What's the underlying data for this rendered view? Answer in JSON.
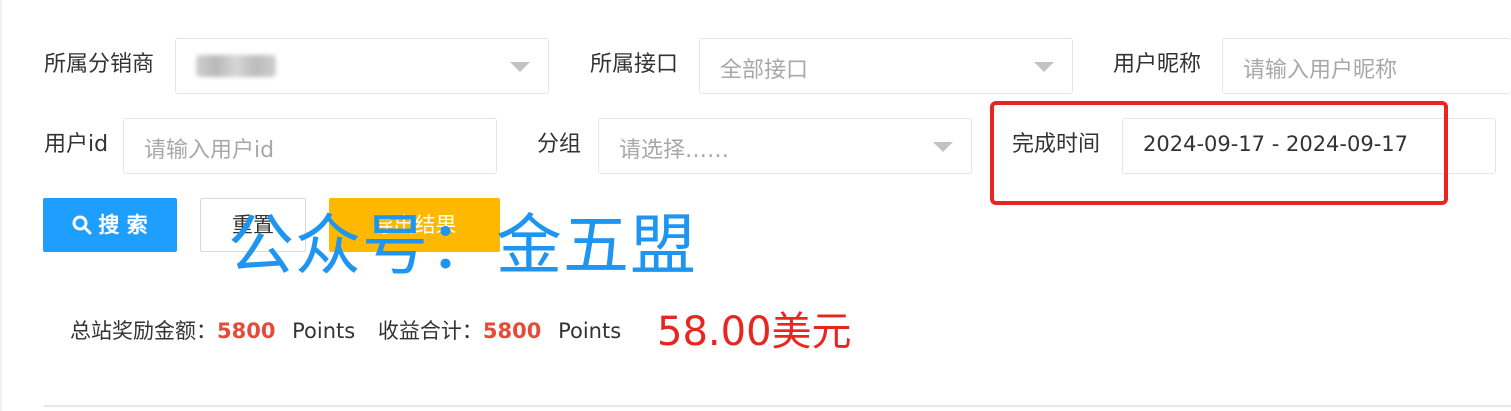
{
  "filters": {
    "distributor_label": "所属分销商",
    "interface_label": "所属接口",
    "interface_value": "全部接口",
    "nickname_label": "用户昵称",
    "nickname_placeholder": "请输入用户昵称",
    "userid_label": "用户id",
    "userid_placeholder": "请输入用户id",
    "group_label": "分组",
    "group_placeholder": "请选择……",
    "complete_time_label": "完成时间",
    "complete_time_value": "2024-09-17 - 2024-09-17"
  },
  "actions": {
    "search_label": "搜 索",
    "reset_label": "重置",
    "export_label": "导出结果"
  },
  "watermark": "公众号：金五盟",
  "stats": {
    "total_reward_label": "总站奖励金额：",
    "total_reward_value": "5800",
    "total_reward_unit": "Points",
    "income_label": "收益合计：",
    "income_value": "5800",
    "income_unit": "Points",
    "usd_amount": "58.00美元"
  },
  "colors": {
    "primary": "#1e9fff",
    "warning": "#ffb800",
    "highlight_red": "#e8251f",
    "number_red": "#e64b3a",
    "watermark_blue": "#1e95f0"
  },
  "icons": [
    "search-icon",
    "chevron-down-icon"
  ]
}
